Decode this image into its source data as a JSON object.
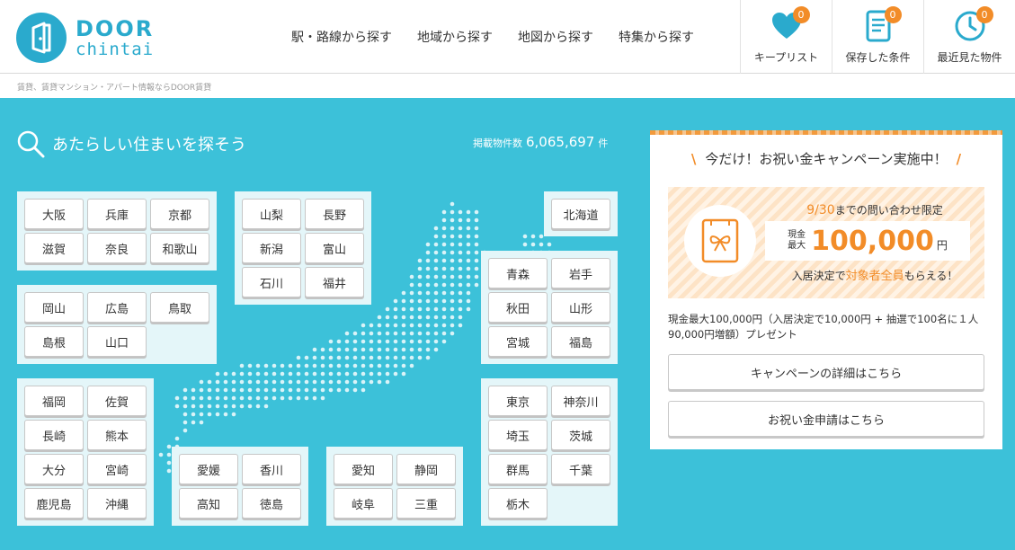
{
  "logo": {
    "line1": "DOOR",
    "line2": "chintai"
  },
  "nav": [
    {
      "label": "駅・路線から探す"
    },
    {
      "label": "地域から探す"
    },
    {
      "label": "地図から探す"
    },
    {
      "label": "特集から探す"
    }
  ],
  "tools": [
    {
      "label": "キープリスト",
      "badge": "0",
      "icon": "heart-icon"
    },
    {
      "label": "保存した条件",
      "badge": "0",
      "icon": "document-icon"
    },
    {
      "label": "最近見た物件",
      "badge": "0",
      "icon": "clock-icon"
    }
  ],
  "breadcrumb": "賃貸、賃貸マンション・アパート情報ならDOOR賃貸",
  "search": {
    "title": "あたらしい住まいを探そう",
    "count_label": "掲載物件数",
    "count_value": "6,065,697",
    "count_unit": "件"
  },
  "regions": {
    "kansai": [
      "大阪",
      "兵庫",
      "京都",
      "滋賀",
      "奈良",
      "和歌山"
    ],
    "koshinetsu": [
      "山梨",
      "長野",
      "新潟",
      "富山",
      "石川",
      "福井"
    ],
    "hokkaido": [
      "北海道"
    ],
    "chugoku": [
      "岡山",
      "広島",
      "鳥取",
      "島根",
      "山口"
    ],
    "tohoku": [
      "青森",
      "岩手",
      "秋田",
      "山形",
      "宮城",
      "福島"
    ],
    "kyushu": [
      "福岡",
      "佐賀",
      "長崎",
      "熊本",
      "大分",
      "宮崎",
      "鹿児島",
      "沖縄"
    ],
    "kanto": [
      "東京",
      "神奈川",
      "埼玉",
      "茨城",
      "群馬",
      "千葉",
      "栃木"
    ],
    "shikoku": [
      "愛媛",
      "香川",
      "高知",
      "徳島"
    ],
    "tokai": [
      "愛知",
      "静岡",
      "岐阜",
      "三重"
    ]
  },
  "campaign": {
    "title": "今だけ！お祝い金キャンペーン実施中！",
    "limit_date": "9/30",
    "limit_text": "までの問い合わせ限定",
    "amount_label_1": "現金",
    "amount_label_2": "最大",
    "amount": "100,000",
    "amount_unit": "円",
    "cond_1": "入居決定で",
    "cond_2": "対象者全員",
    "cond_3": "もらえる！",
    "note": "現金最大100,000円（入居決定で10,000円 + 抽選で100名に１人90,000円増額）プレゼント",
    "detail_button": "キャンペーンの詳細はこちら",
    "apply_button": "お祝い金申請はこちら"
  },
  "colors": {
    "brand": "#2aaacd",
    "main_bg": "#3cc1d9",
    "accent": "#f28c28"
  }
}
